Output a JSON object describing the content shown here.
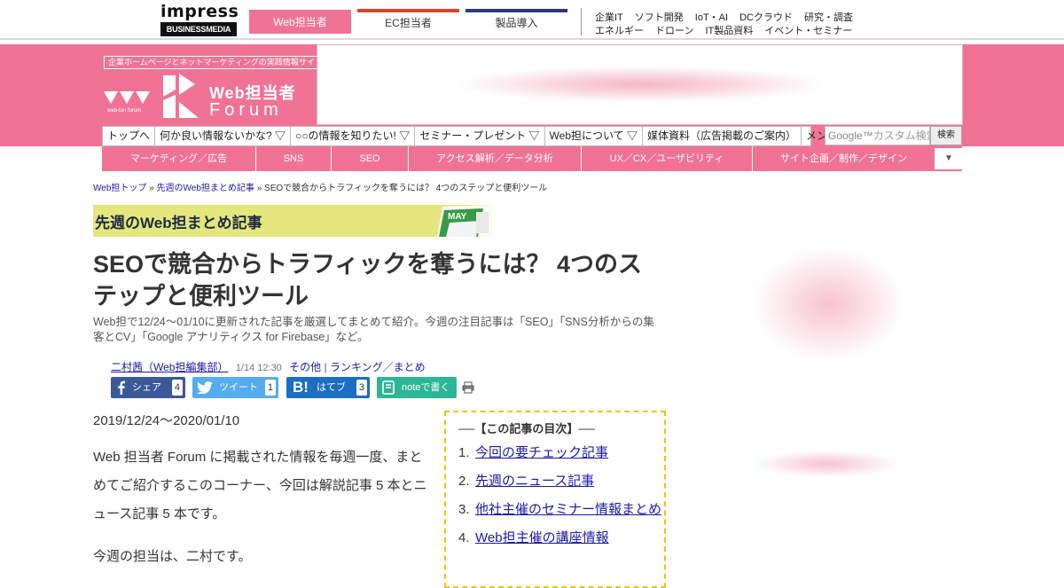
{
  "topbar": {
    "logo_word": "impress",
    "logo_sub": "BUSINESSMEDIA",
    "site_tabs": [
      "Web担当者",
      "EC担当者",
      "製品導入"
    ],
    "links_row1": [
      "企業IT",
      "ソフト開発",
      "IoT・AI",
      "DCクラウド",
      "研究・調査"
    ],
    "links_row2": [
      "エネルギー",
      "ドローン",
      "IT製品資料",
      "イベント・セミナー"
    ]
  },
  "header": {
    "tagline": "企業ホームページとネットマーケティングの実践情報サイト",
    "logo_jp": "Web担当者",
    "logo_forum": "Forum",
    "logo_small": "web-tan forum"
  },
  "mainnav": {
    "items": [
      "トップへ",
      "何か良い情報ないかな? ▽",
      "○○の情報を知りたい! ▽",
      "セミナー・プレゼント ▽",
      "Web担について ▽",
      "媒体資料（広告掲載のご案内）",
      "メンバー ▽"
    ],
    "search_placeholder_brand": "Google™",
    "search_placeholder": "カスタム検索",
    "search_button": "検索"
  },
  "catnav": {
    "items": [
      "マーケティング／広告",
      "SNS",
      "SEO",
      "アクセス解析／データ分析",
      "UX／CX／ユーザビリティ",
      "サイト企画／制作／デザイン"
    ],
    "more": "▼"
  },
  "breadcrumb": {
    "home": "Web担トップ",
    "section": "先週のWeb担まとめ記事",
    "current": "SEOで競合からトラフィックを奪うには？ 4つのステップと便利ツール",
    "sep": "»"
  },
  "section": {
    "title": "先週のWeb担まとめ記事",
    "calendar_label": "MAY"
  },
  "article": {
    "title": "SEOで競合からトラフィックを奪うには？ 4つのステップと便利ツール",
    "lead": "Web担で12/24～01/10に更新された記事を厳選してまとめて紹介。今週の注目記事は「SEO」「SNS分析からの集客とCV」「Google アナリティクス for Firebase」など。",
    "author": "二村茜（Web担編集部）",
    "date": "1/14 12:30",
    "category1": "その他",
    "category_sep": "|",
    "category2": "ランキング／まとめ",
    "date_range": "2019/12/24～2020/01/10",
    "para1": "Web 担当者 Forum に掲載された情報を毎週一度、まとめてご紹介するこのコーナー、今回は解説記事 5 本とニュース記事 5 本です。",
    "para2": "今週の担当は、二村です。"
  },
  "share": {
    "facebook_label": "シェア",
    "facebook_count": "4",
    "twitter_label": "ツイート",
    "twitter_count": "1",
    "hatena_label": "はてブ",
    "hatena_count": "3",
    "note_label": "noteで書く"
  },
  "toc": {
    "title": "──【この記事の目次】──",
    "items": [
      {
        "num": "1.",
        "label": "今回の要チェック記事"
      },
      {
        "num": "2.",
        "label": "先週のニュース記事"
      },
      {
        "num": "3.",
        "label": "他社主催のセミナー情報まとめ"
      },
      {
        "num": "4.",
        "label": "Web担主催の講座情報"
      }
    ]
  },
  "colors": {
    "brand_pink": "#f07396",
    "link_blue": "#1a1aa6",
    "banner_yellow": "#e4e67e",
    "facebook": "#3b5998",
    "twitter": "#55acee",
    "hatena": "#1b6ec2",
    "note": "#2cb696"
  }
}
